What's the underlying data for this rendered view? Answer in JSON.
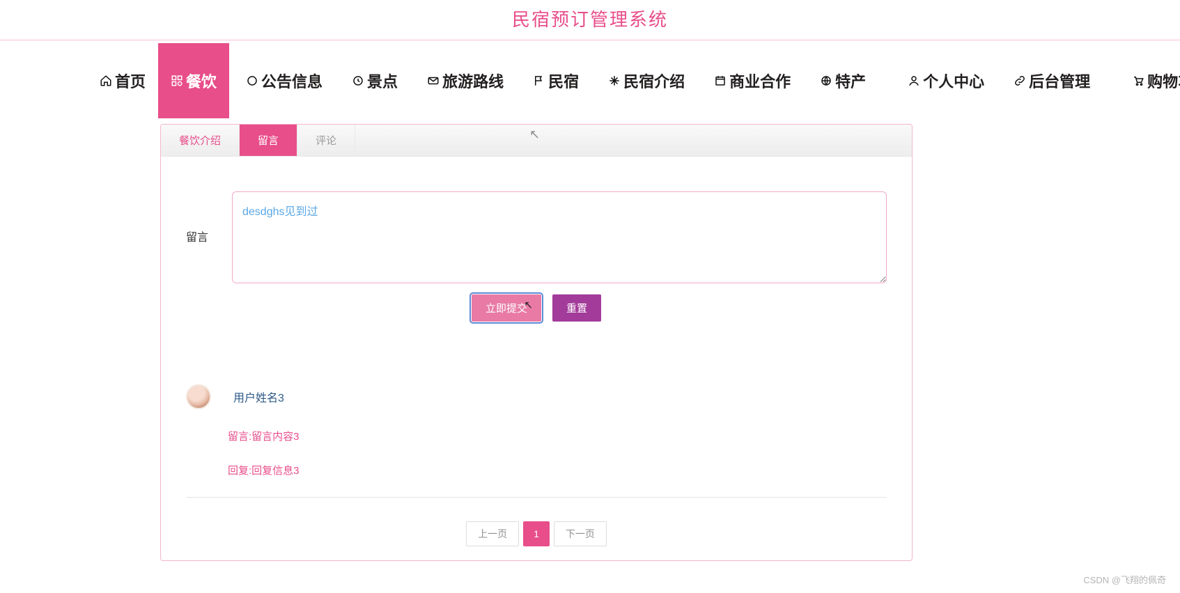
{
  "site": {
    "title": "民宿预订管理系统"
  },
  "nav": {
    "items": [
      {
        "label": "首页"
      },
      {
        "label": "餐饮"
      },
      {
        "label": "公告信息"
      },
      {
        "label": "景点"
      },
      {
        "label": "旅游路线"
      },
      {
        "label": "民宿"
      },
      {
        "label": "民宿介绍"
      },
      {
        "label": "商业合作"
      },
      {
        "label": "特产"
      },
      {
        "label": "个人中心"
      },
      {
        "label": "后台管理"
      },
      {
        "label": "购物车"
      }
    ]
  },
  "tabs": {
    "intro": "餐饮介绍",
    "message": "留言",
    "comment": "评论"
  },
  "form": {
    "label": "留言",
    "textarea_value": "desdghs见到过",
    "submit": "立即提交",
    "reset": "重置"
  },
  "comment": {
    "username": "用户姓名3",
    "msg": "留言:留言内容3",
    "reply": "回复:回复信息3"
  },
  "pager": {
    "prev": "上一页",
    "current": "1",
    "next": "下一页"
  },
  "watermark": "CSDN @飞翔的佩奇"
}
